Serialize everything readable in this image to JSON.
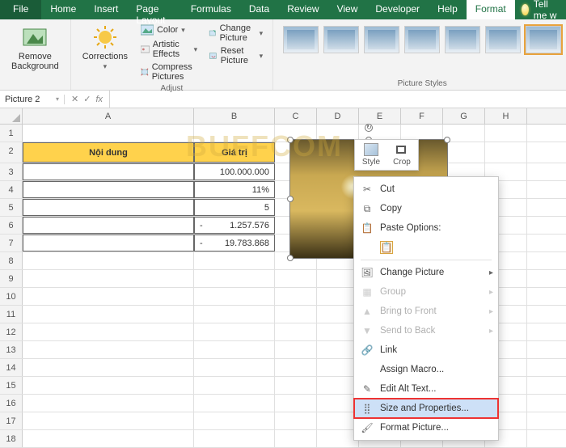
{
  "tabs": {
    "file": "File",
    "home": "Home",
    "insert": "Insert",
    "page_layout": "Page Layout",
    "formulas": "Formulas",
    "data": "Data",
    "review": "Review",
    "view": "View",
    "developer": "Developer",
    "help": "Help",
    "format": "Format",
    "tell_me": "Tell me w"
  },
  "ribbon": {
    "remove_bg": "Remove\nBackground",
    "corrections": "Corrections",
    "color": "Color",
    "artistic": "Artistic Effects",
    "compress": "Compress Pictures",
    "change_pic": "Change Picture",
    "reset_pic": "Reset Picture",
    "group_adjust": "Adjust",
    "group_styles": "Picture Styles"
  },
  "name_box": "Picture 2",
  "fx": {
    "cancel": "✕",
    "confirm": "✓",
    "fx": "fx"
  },
  "columns": [
    "A",
    "B",
    "C",
    "D",
    "E",
    "F",
    "G",
    "H"
  ],
  "rows": [
    "1",
    "2",
    "3",
    "4",
    "5",
    "6",
    "7",
    "8",
    "9",
    "10",
    "11",
    "12",
    "13",
    "14",
    "15",
    "16",
    "17",
    "18"
  ],
  "table": {
    "header_a": "Nội dung",
    "header_b": "Giá trị",
    "r3": "100.000.000",
    "r4": "11%",
    "r5": "5",
    "r6_dash": "-",
    "r6": "1.257.576",
    "r7_dash": "-",
    "r7": "19.783.868"
  },
  "mini": {
    "style": "Style",
    "crop": "Crop"
  },
  "menu": {
    "cut": "Cut",
    "copy": "Copy",
    "paste_options": "Paste Options:",
    "change_picture": "Change Picture",
    "group": "Group",
    "bring_front": "Bring to Front",
    "send_back": "Send to Back",
    "link": "Link",
    "assign_macro": "Assign Macro...",
    "edit_alt": "Edit Alt Text...",
    "size_props": "Size and Properties...",
    "format_picture": "Format Picture..."
  },
  "watermark": "BUFFCOM"
}
